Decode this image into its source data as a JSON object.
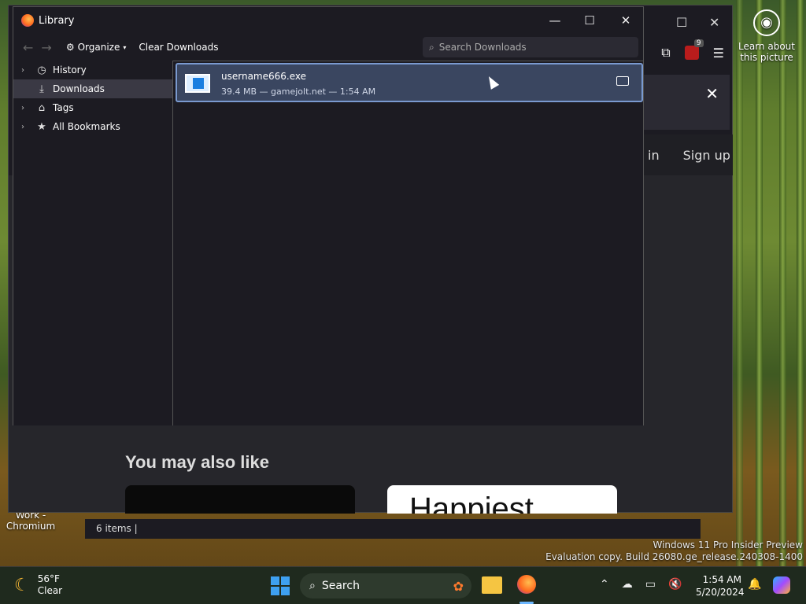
{
  "desktop": {
    "learn_about": "Learn about this picture",
    "watermark_line1": "Windows 11 Pro Insider Preview",
    "watermark_line2": "Evaluation copy. Build 26080.ge_release.240308-1400",
    "shortcut_label": "Work - Chromium"
  },
  "browser": {
    "extensions_badge": "9",
    "sign_in": "in",
    "sign_up": "Sign up",
    "section_title": "You may also like",
    "card2_text": "Happiest",
    "status_items": "6 items"
  },
  "library": {
    "title": "Library",
    "organize_label": "Organize",
    "clear_downloads_label": "Clear Downloads",
    "search_placeholder": "Search Downloads",
    "sidebar": {
      "items": [
        {
          "label": "History",
          "icon": "clock-icon",
          "expandable": true
        },
        {
          "label": "Downloads",
          "icon": "download-icon",
          "expandable": false,
          "selected": true
        },
        {
          "label": "Tags",
          "icon": "tag-icon",
          "expandable": true
        },
        {
          "label": "All Bookmarks",
          "icon": "star-icon",
          "expandable": true
        }
      ]
    },
    "downloads": [
      {
        "name": "username666.exe",
        "meta": "39.4 MB — gamejolt.net — 1:54 AM"
      }
    ]
  },
  "taskbar": {
    "weather_temp": "56°F",
    "weather_desc": "Clear",
    "search_label": "Search",
    "time": "1:54 AM",
    "date": "5/20/2024"
  }
}
